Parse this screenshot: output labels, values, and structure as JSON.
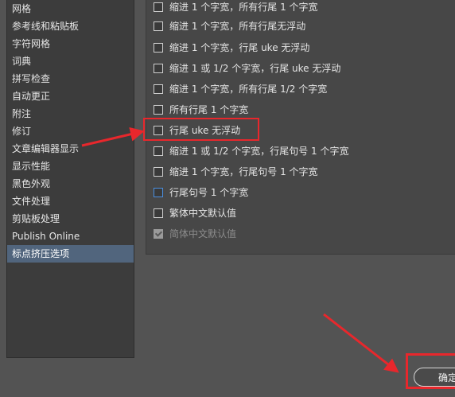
{
  "sidebar": {
    "items": [
      {
        "label": "网格"
      },
      {
        "label": "参考线和粘贴板"
      },
      {
        "label": "字符网格"
      },
      {
        "label": "词典"
      },
      {
        "label": "拼写检查"
      },
      {
        "label": "自动更正"
      },
      {
        "label": "附注"
      },
      {
        "label": "修订"
      },
      {
        "label": "文章编辑器显示"
      },
      {
        "label": "显示性能"
      },
      {
        "label": "黑色外观"
      },
      {
        "label": "文件处理"
      },
      {
        "label": "剪贴板处理"
      },
      {
        "label": "Publish Online"
      },
      {
        "label": "标点挤压选项",
        "selected": true
      }
    ]
  },
  "options": [
    {
      "label": "缩进 1 个字宽，所有行尾 1 个字宽",
      "checked": false
    },
    {
      "label": "缩进 1 个字宽，所有行尾无浮动",
      "checked": false
    },
    {
      "label": "缩进 1 个字宽，行尾 uke 无浮动",
      "checked": false
    },
    {
      "label": "缩进 1 或 1/2 个字宽，行尾 uke 无浮动",
      "checked": false
    },
    {
      "label": "缩进 1 个字宽，所有行尾 1/2 个字宽",
      "checked": false
    },
    {
      "label": "所有行尾 1 个字宽",
      "checked": false
    },
    {
      "label": "行尾 uke 无浮动",
      "checked": false,
      "highlighted": true
    },
    {
      "label": "缩进 1 或 1/2 个字宽，行尾句号 1 个字宽",
      "checked": false
    },
    {
      "label": "缩进 1 个字宽，行尾句号 1 个字宽",
      "checked": false
    },
    {
      "label": "行尾句号 1 个字宽",
      "checked": false,
      "focused": true
    },
    {
      "label": "繁体中文默认值",
      "checked": false
    },
    {
      "label": "简体中文默认值",
      "checked": true,
      "disabled": true
    }
  ],
  "footer": {
    "ok_label": "确定"
  },
  "colors": {
    "annotation_red": "#e8272c",
    "selection_blue": "#51657d"
  }
}
